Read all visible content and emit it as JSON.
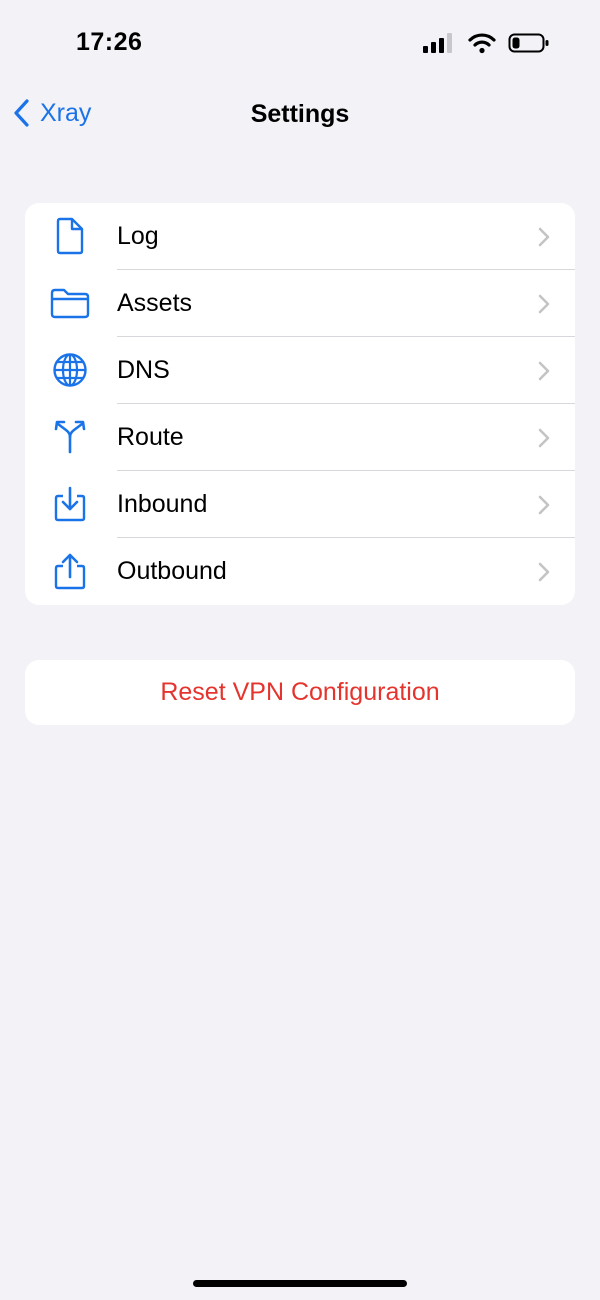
{
  "status_bar": {
    "time": "17:26",
    "icons": [
      "cellular-signal-icon",
      "wifi-icon",
      "battery-icon"
    ],
    "battery_level": 0.25
  },
  "nav": {
    "back_label": "Xray",
    "back_icon": "chevron-left-icon",
    "title": "Settings"
  },
  "menu": {
    "items": [
      {
        "label": "Log",
        "icon": "document-icon"
      },
      {
        "label": "Assets",
        "icon": "folder-icon"
      },
      {
        "label": "DNS",
        "icon": "globe-icon"
      },
      {
        "label": "Route",
        "icon": "route-split-icon"
      },
      {
        "label": "Inbound",
        "icon": "tray-arrow-down-icon"
      },
      {
        "label": "Outbound",
        "icon": "share-arrow-up-icon"
      }
    ]
  },
  "reset": {
    "label": "Reset VPN Configuration"
  },
  "colors": {
    "accent": "#1a73e8",
    "destructive": "#e5342d",
    "background": "#f2f2f7",
    "card": "#ffffff",
    "chevron": "#c4c4c7"
  }
}
